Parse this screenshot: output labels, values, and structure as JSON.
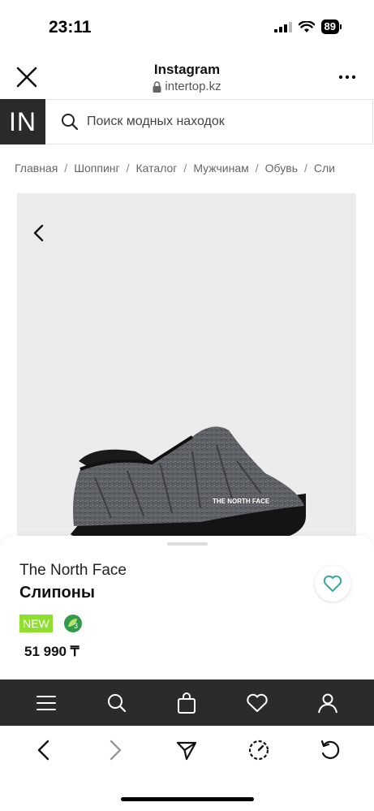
{
  "status_bar": {
    "time": "23:11",
    "battery": "89"
  },
  "browser": {
    "title": "Instagram",
    "url": "intertop.kz"
  },
  "site": {
    "logo": "IN",
    "search": {
      "placeholder": "Поиск модных находок"
    }
  },
  "breadcrumb": [
    "Главная",
    "Шоппинг",
    "Каталог",
    "Мужчинам",
    "Обувь",
    "Сли"
  ],
  "product": {
    "brand": "The North Face",
    "name": "Слипоны",
    "badge": "NEW",
    "eco_badge": "3",
    "price": "51 990 ₸",
    "shoe_logo": "THE NORTH FACE",
    "gallery": {
      "image_count": 4,
      "active_index": 0
    }
  },
  "site_nav": [
    "menu-icon",
    "search-icon",
    "bag-icon",
    "heart-icon",
    "profile-icon"
  ],
  "browser_toolbar": [
    "back-icon",
    "forward-icon",
    "share-icon",
    "speed-icon",
    "reload-icon"
  ],
  "colors": {
    "nav_background": "#2b2b2b",
    "badge_new": "#8ee02c",
    "favorite_accent": "#3aa99a",
    "image_background": "#ececec"
  }
}
